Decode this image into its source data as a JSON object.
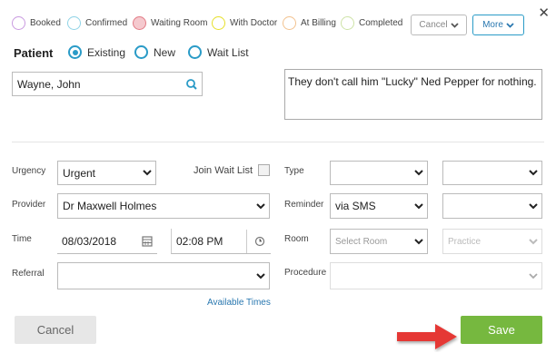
{
  "statuses": [
    {
      "label": "Booked",
      "color": "#c99ae0",
      "fill": "#ffffff"
    },
    {
      "label": "Confirmed",
      "color": "#8fd3e6",
      "fill": "#ffffff"
    },
    {
      "label": "Waiting Room",
      "color": "#e27b86",
      "fill": "#f5c9ce"
    },
    {
      "label": "With Doctor",
      "color": "#e6df2a",
      "fill": "#ffffff"
    },
    {
      "label": "At Billing",
      "color": "#f2c28f",
      "fill": "#ffffff"
    },
    {
      "label": "Completed",
      "color": "#cde3a6",
      "fill": "#ffffff"
    }
  ],
  "toolbar": {
    "cancel_label": "Cancel",
    "more_label": "More"
  },
  "patient": {
    "title": "Patient",
    "options": [
      "Existing",
      "New",
      "Wait List"
    ],
    "selected": "Existing",
    "search_value": "Wayne, John"
  },
  "note": "They don't call him \"Lucky\" Ned Pepper for nothing.",
  "form": {
    "urgency_label": "Urgency",
    "urgency_value": "Urgent",
    "join_wait_list_label": "Join Wait List",
    "type_label": "Type",
    "provider_label": "Provider",
    "provider_value": "Dr Maxwell Holmes",
    "reminder_label": "Reminder",
    "reminder_value": "via SMS",
    "time_label": "Time",
    "date_value": "08/03/2018",
    "time_value": "02:08 PM",
    "room_label": "Room",
    "room_placeholder": "Select Room",
    "practice_placeholder": "Practice",
    "referral_label": "Referral",
    "procedure_label": "Procedure",
    "available_times_link": "Available Times"
  },
  "footer": {
    "cancel_label": "Cancel",
    "save_label": "Save"
  },
  "colors": {
    "accent": "#2a9bc7",
    "save": "#76b83f",
    "arrow": "#e53935"
  }
}
